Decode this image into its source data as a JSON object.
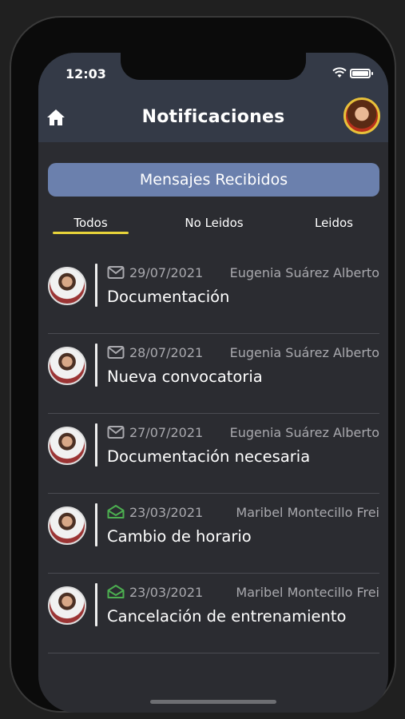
{
  "status_bar": {
    "time": "12:03"
  },
  "header": {
    "title": "Notificaciones"
  },
  "banner": {
    "label": "Mensajes Recibidos"
  },
  "tabs": [
    {
      "label": "Todos",
      "selected": true
    },
    {
      "label": "No Leidos",
      "selected": false
    },
    {
      "label": "Leidos",
      "selected": false
    }
  ],
  "colors": {
    "accent_underline": "#e8d43a",
    "banner_bg": "#6b80ad",
    "read_icon": "#4caf50",
    "unread_icon": "#a9a9ae"
  },
  "messages": [
    {
      "date": "29/07/2021",
      "sender": "Eugenia Suárez Alberto",
      "subject": "Documentación",
      "icon": "envelope-closed-icon",
      "read": false
    },
    {
      "date": "28/07/2021",
      "sender": "Eugenia Suárez Alberto",
      "subject": "Nueva convocatoria",
      "icon": "envelope-closed-icon",
      "read": false
    },
    {
      "date": "27/07/2021",
      "sender": "Eugenia Suárez Alberto",
      "subject": "Documentación necesaria",
      "icon": "envelope-closed-icon",
      "read": false
    },
    {
      "date": "23/03/2021",
      "sender": "Maribel Montecillo Frei",
      "subject": "Cambio de horario",
      "icon": "envelope-open-icon",
      "read": true
    },
    {
      "date": "23/03/2021",
      "sender": "Maribel Montecillo Frei",
      "subject": "Cancelación de entrenamiento",
      "icon": "envelope-open-icon",
      "read": true
    }
  ]
}
